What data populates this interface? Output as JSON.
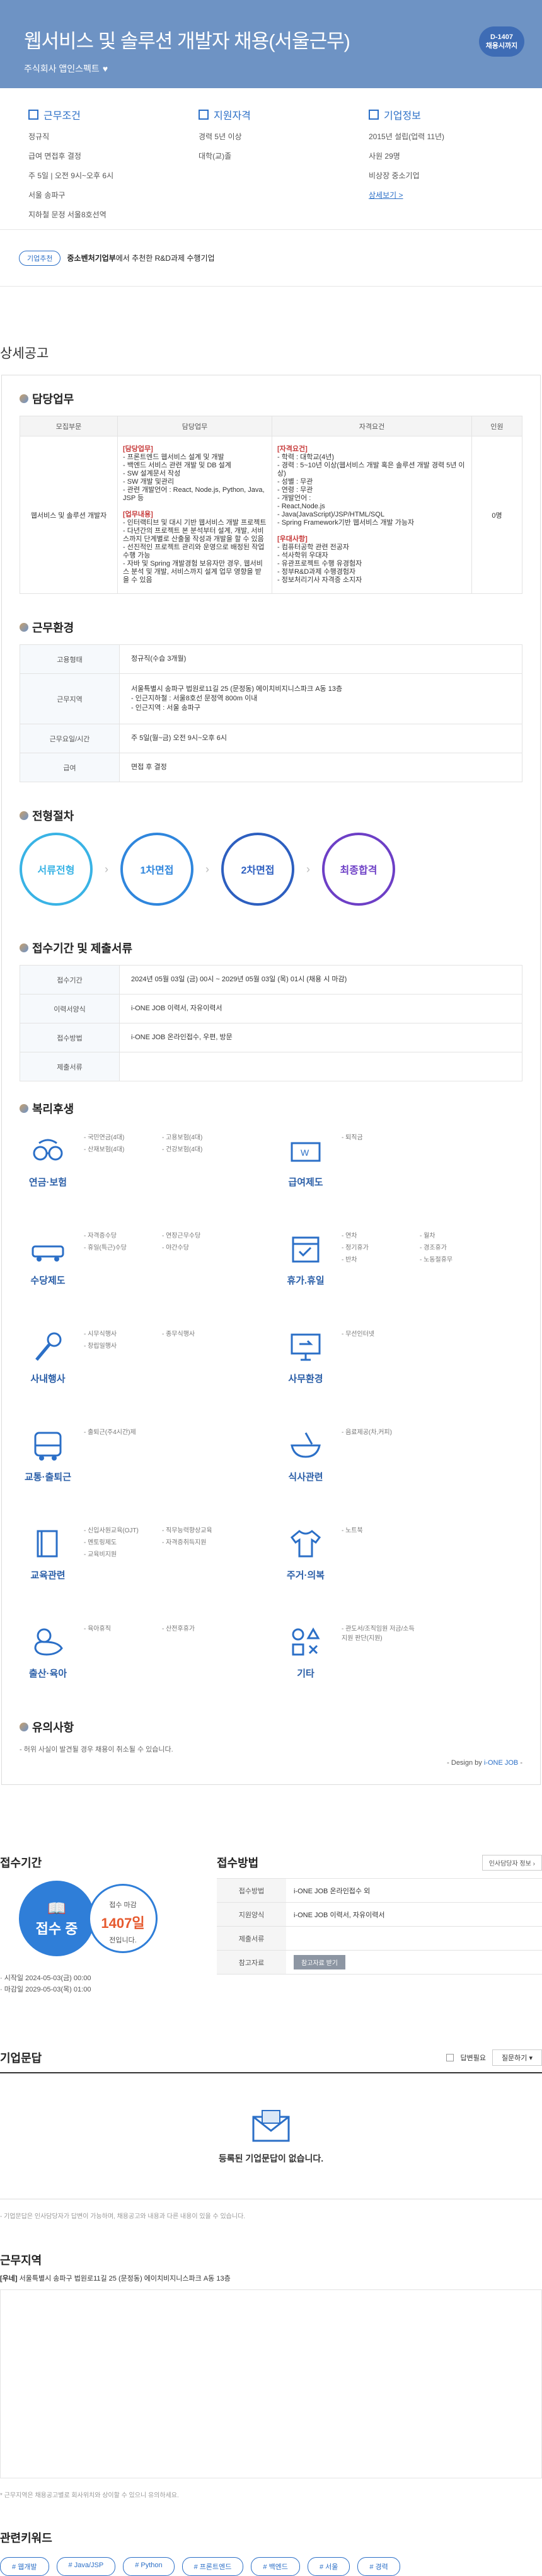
{
  "hero": {
    "title": "웹서비스 및 솔루션 개발자 채용(서울근무)",
    "company": "주식회사 앱인스펙트",
    "dday": "D-1407",
    "dday_sub": "채용시까지"
  },
  "summary": [
    {
      "title": "근무조건",
      "items": [
        "정규직",
        "급여 면접후 결정",
        "주 5일 | 오전 9시~오후 6시",
        "서울 송파구",
        "지하철 문정 서울8호선역"
      ]
    },
    {
      "title": "지원자격",
      "items": [
        "경력 5년 이상",
        "대학(교)졸"
      ]
    },
    {
      "title": "기업정보",
      "items": [
        "2015년 설립(업력 11년)",
        "사원 29명",
        "비상장 중소기업"
      ],
      "link": "상세보기 >"
    }
  ],
  "tag": {
    "pill": "기업추천",
    "text_bold": "중소벤처기업부",
    "text": "에서 추천한 R&D과제 수행기업"
  },
  "detail_heading": "상세공고",
  "duty": {
    "title": "담당업무",
    "headers": [
      "모집부문",
      "담당업무",
      "자격요건",
      "인원"
    ],
    "part": "웹서비스 및 솔루션 개발자",
    "work": [
      "[담당업무]",
      "- 프론트엔드 웹서비스 설계 및 개발",
      "- 백엔드 서비스 관련 개발 및 DB 설계",
      "- SW 설계문서 작성",
      "- SW 개발 및관리",
      "- 관련 개발언어 : React, Node.js, Python, Java, JSP 등",
      "",
      "[업무내용]",
      "- 인터랙티브 및 대시 기반 웹서비스 개발 프로젝트",
      "- 다년간의 프로젝트 본 분석부터 설계, 개발, 서비스까지 단계별로 산출물 작성과 개발을 할 수 있음",
      "- 선진적인 프로젝트 관리와 운영으로 배정된 작업 수행 가능",
      "- 자바 및 Spring 개발경험 보유자만 경우, 웹서비스 분석 및 개발, 서비스까지 설계 업무 영향을 받을 수 있음"
    ],
    "req": [
      "[자격요건]",
      "- 학력 : 대학교(4년)",
      "- 경력 : 5~10년 이상(웹서비스 개발 혹은 솔루션 개발 경력 5년 이상)",
      "- 성별 : 무관",
      "- 연령 : 무관",
      "- 개발언어 :",
      "  - React,Node.js",
      "  - Java(JavaScript)/JSP/HTML/SQL",
      "  - Spring Framework기반 웹서비스 개발 가능자",
      "",
      "[우대사항]",
      "- 컴퓨터공학 관련 전공자",
      "- 석사학위 우대자",
      "- 유관프로젝트 수행 유경험자",
      "- 정부R&D과제 수행경험자",
      "- 정보처리기사 자격증 소지자"
    ],
    "count": "0명"
  },
  "env": {
    "title": "근무환경",
    "rows": [
      {
        "k": "고용형태",
        "v": "정규직(수습 3개월)"
      },
      {
        "k": "근무지역",
        "v": "서울특별시 송파구 법원로11길 25 (문정동) 에이치비지니스파크 A동 13층\n- 인근지하철 : 서울8호선 문정역 800m 이내\n- 인근지역 : 서울 송파구"
      },
      {
        "k": "근무요일/시간",
        "v": "주 5일(월~금) 오전 9시~오후 6시"
      },
      {
        "k": "급여",
        "v": "면접 후 결정"
      }
    ]
  },
  "process": {
    "title": "전형절차",
    "steps": [
      "서류전형",
      "1차면접",
      "2차면접",
      "최종합격"
    ]
  },
  "submit": {
    "title": "접수기간 및 제출서류",
    "rows": [
      {
        "k": "접수기간",
        "v": "2024년 05월 03일 (금) 00시 ~ 2029년 05월 03일 (목) 01시 (채용 시 마감)"
      },
      {
        "k": "이력서양식",
        "v": "i-ONE JOB 이력서, 자유이력서"
      },
      {
        "k": "접수방법",
        "v": "i-ONE JOB 온라인접수, 우편, 방문"
      },
      {
        "k": "제출서류",
        "v": ""
      }
    ]
  },
  "welfare": {
    "title": "복리후생",
    "items": [
      {
        "label": "연금·보험",
        "icon": "glasses-icon",
        "list": [
          "국민연금(4대)",
          "고용보험(4대)",
          "산재보험(4대)",
          "건강보험(4대)"
        ]
      },
      {
        "label": "급여제도",
        "icon": "money-icon",
        "list": [
          "퇴직금"
        ]
      },
      {
        "label": "수당제도",
        "icon": "car-icon",
        "list": [
          "자격증수당",
          "연장근무수당",
          "휴일(특근)수당",
          "야간수당"
        ]
      },
      {
        "label": "휴가.휴일",
        "icon": "calendar-icon",
        "list": [
          "연차",
          "월차",
          "정기휴가",
          "경조휴가",
          "반차",
          "노동절휴무"
        ]
      },
      {
        "label": "사내행사",
        "icon": "microphone-icon",
        "list": [
          "시무식행사",
          "종무식행사",
          "창립일행사"
        ]
      },
      {
        "label": "사무환경",
        "icon": "monitor-icon",
        "list": [
          "무선인터넷"
        ]
      },
      {
        "label": "교통·출퇴근",
        "icon": "bus-icon",
        "list": [
          "출퇴근(주4시간)제"
        ]
      },
      {
        "label": "식사관련",
        "icon": "bowl-icon",
        "list": [
          "음료제공(차,커피)"
        ]
      },
      {
        "label": "교육관련",
        "icon": "book-icon",
        "list": [
          "신입사원교육(OJT)",
          "직무능력향상교육",
          "멘토링제도",
          "자격증취득지원",
          "교육비지원"
        ]
      },
      {
        "label": "주거·의복",
        "icon": "shirt-icon",
        "list": [
          "노트북"
        ]
      },
      {
        "label": "출산·육아",
        "icon": "duck-icon",
        "list": [
          "육아휴직",
          "산전후휴가"
        ]
      },
      {
        "label": "기타",
        "icon": "shapes-icon",
        "list": [
          "관도서/조직임원 저금/소득지원 판단(지원)"
        ]
      }
    ]
  },
  "notice": {
    "title": "유의사항",
    "text": "- 허위 사실이 발견될 경우 채용이 취소될 수 있습니다.",
    "design_pre": "- Design by ",
    "design_brand": "i-ONE JOB"
  },
  "deadline": {
    "title": "접수기간",
    "status": "접수 중",
    "until_label": "접수 마감",
    "days": "1407일",
    "after": "전입니다.",
    "start": "· 시작일 2024-05-03(금) 00:00",
    "end": "· 마감일 2029-05-03(목) 01:00"
  },
  "method": {
    "title": "접수방법",
    "dropdown": "인사담당자 정보",
    "rows": [
      {
        "k": "접수방법",
        "v": "i-ONE JOB 온라인접수 외"
      },
      {
        "k": "지원양식",
        "v": "i-ONE JOB 이력서, 자유이력서"
      },
      {
        "k": "제출서류",
        "v": ""
      },
      {
        "k": "참고자료",
        "v": "참고자료 받기"
      }
    ]
  },
  "qa": {
    "title": "기업문답",
    "checkbox": "답변필요",
    "select": "질문하기",
    "empty": "등록된 기업문답이 없습니다."
  },
  "note1": "- 기업문답은 인사담당자가 답변이 가능하며, 채용공고와 내용과 다른 내용이 있을 수 있습니다.",
  "region": {
    "title": "근무지역",
    "addr_tag": "[우네]",
    "addr": "서울특별시 송파구 법원로11길 25 (문정동) 에이치비지니스파크 A동 13층"
  },
  "note2": "* 근무지역은 채용공고별로 회사위치와 상이할 수 있으니 유의하세요.",
  "keywords": {
    "title": "관련키워드",
    "items": [
      "# 웹개발",
      "# Java/JSP",
      "# Python",
      "# 프론트엔드",
      "# 백엔드",
      "# 서울",
      "# 경력"
    ]
  },
  "colors": {
    "accent": "#2b6fc7",
    "hero": "#6e93c4",
    "step1": "#39b3e5",
    "step2": "#2f86dd",
    "step3": "#2d5fc0",
    "step4": "#6d3fc6"
  }
}
